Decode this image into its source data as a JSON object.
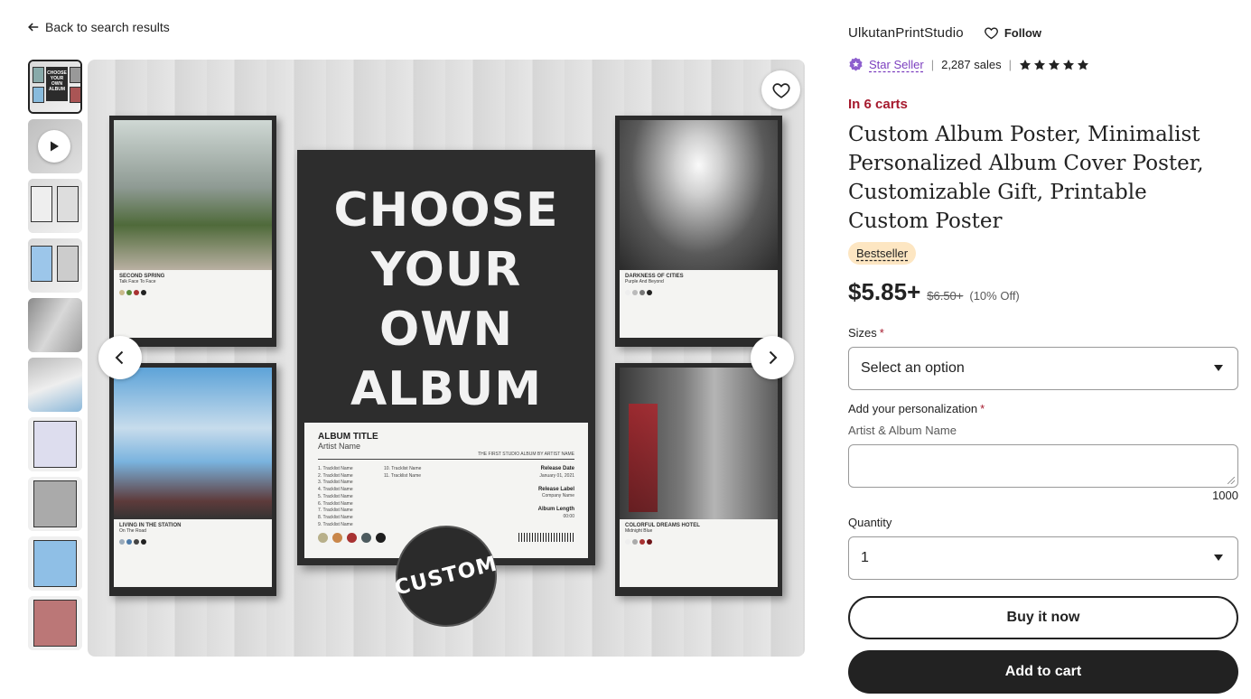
{
  "nav": {
    "back_label": "Back to search results"
  },
  "gallery": {
    "main_headline": "CHOOSE YOUR OWN ALBUM",
    "badge_text": "CUSTOM",
    "thumbnail_headline": "CHOOSE YOUR OWN ALBUM",
    "center_card": {
      "album_title": "ALBUM TITLE",
      "artist": "Artist Name",
      "studio_line": "THE FIRST STUDIO ALBUM BY ARTIST NAME",
      "tracks_col1": [
        "1. Tracklist Name",
        "2. Tracklist Name",
        "3. Tracklist Name",
        "4. Tracklist Name",
        "5. Tracklist Name",
        "6. Tracklist Name",
        "7. Tracklist Name",
        "8. Tracklist Name",
        "9. Tracklist Name"
      ],
      "tracks_col2": [
        "10. Tracklist Name",
        "11. Tracklist Name"
      ],
      "release_date_label": "Release Date",
      "release_date": "January 01, 2021",
      "release_label_label": "Release Label",
      "release_label": "Company Name",
      "album_length_label": "Album Length",
      "album_length": "00:00",
      "swatch_colors": [
        "#b8b08a",
        "#c9874a",
        "#a83232",
        "#4c5a5e",
        "#1e1e1e"
      ]
    },
    "posters": [
      {
        "title": "SECOND SPRING",
        "artist": "Talk Face To Face"
      },
      {
        "title": "DARKNESS OF CITIES",
        "artist": "Purple And Beyond"
      },
      {
        "title": "LIVING IN THE STATION",
        "artist": "On The Road"
      },
      {
        "title": "COLORFUL DREAMS HOTEL",
        "artist": "Midnight Blue"
      }
    ]
  },
  "shop": {
    "name": "UlkutanPrintStudio",
    "follow_label": "Follow",
    "star_seller_label": "Star Seller",
    "sales": "2,287 sales",
    "rating_stars": 5
  },
  "listing": {
    "in_carts": "In 6 carts",
    "title": "Custom Album Poster, Minimalist Personalized Album Cover Poster, Customizable Gift, Printable Custom Poster",
    "badge": "Bestseller",
    "price": "$5.85+",
    "original_price": "$6.50+",
    "discount": "(10% Off)"
  },
  "form": {
    "sizes_label": "Sizes",
    "required_mark": "*",
    "sizes_value": "Select an option",
    "personalization_label": "Add your personalization",
    "personalization_sublabel": "Artist & Album Name",
    "char_limit": "1000",
    "quantity_label": "Quantity",
    "quantity_value": "1"
  },
  "actions": {
    "buy_now": "Buy it now",
    "add_to_cart": "Add to cart"
  },
  "colors": {
    "accent_red": "#a61a2e",
    "star_seller_purple": "#7c3fbf",
    "bestseller_bg": "#fde6c2",
    "dark": "#222222"
  }
}
